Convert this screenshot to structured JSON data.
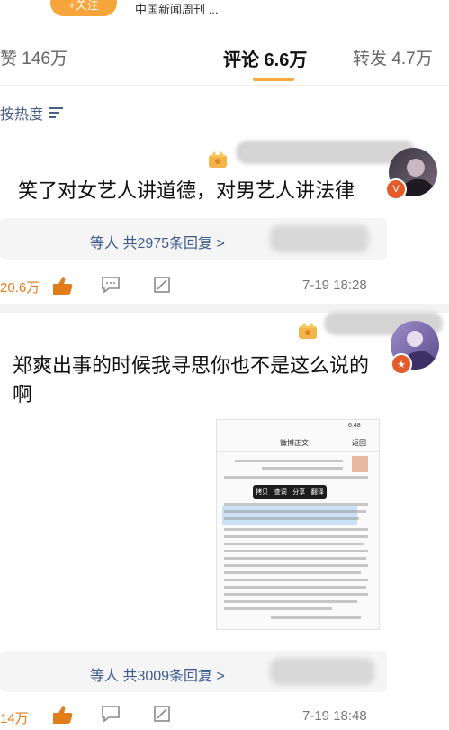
{
  "topbar": {
    "follow_label": "+关注",
    "source_text": "中国新闻周刊 ..."
  },
  "tabs": {
    "likes": "赞 146万",
    "comments": "评论 6.6万",
    "reposts": "转发 4.7万"
  },
  "sort_label": "按热度",
  "comments": [
    {
      "text": "笑了对女艺人讲道德，对男艺人讲法律",
      "reply_label": "等人 共2975条回复 >",
      "likes": "20.6万",
      "time": "7-19 18:28"
    },
    {
      "text": "郑爽出事的时候我寻思你也不是这么说的啊",
      "reply_label": "等人 共3009条回复 >",
      "likes": "14万",
      "time": "7-19 18:48"
    }
  ],
  "embedded_screenshot": {
    "status_time": "6:48",
    "header_title": "微博正文",
    "back_label": "返回",
    "menu_items": [
      "拷贝",
      "查词",
      "分享",
      "翻译"
    ]
  },
  "colors": {
    "accent": "#f7a93b",
    "link": "#3b5a8e",
    "like": "#e07c1a"
  }
}
